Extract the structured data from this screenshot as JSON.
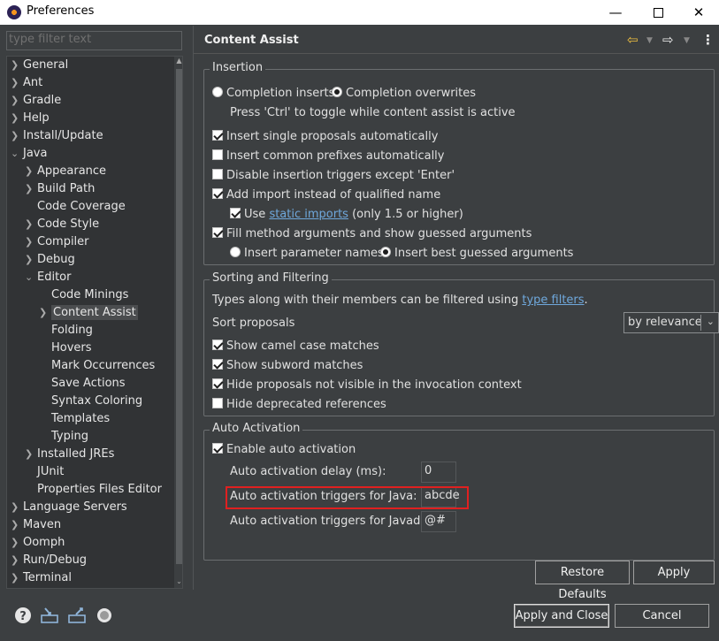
{
  "window": {
    "title": "Preferences"
  },
  "colors": {
    "background": "#3c3f41",
    "link": "#6fa8dc",
    "highlight": "#e02020"
  },
  "filter": {
    "placeholder": "type filter text"
  },
  "tree": {
    "items": [
      {
        "label": "General"
      },
      {
        "label": "Ant"
      },
      {
        "label": "Gradle"
      },
      {
        "label": "Help"
      },
      {
        "label": "Install/Update"
      },
      {
        "label": "Java"
      },
      {
        "label": "Appearance"
      },
      {
        "label": "Build Path"
      },
      {
        "label": "Code Coverage"
      },
      {
        "label": "Code Style"
      },
      {
        "label": "Compiler"
      },
      {
        "label": "Debug"
      },
      {
        "label": "Editor"
      },
      {
        "label": "Code Minings"
      },
      {
        "label": "Content Assist"
      },
      {
        "label": "Folding"
      },
      {
        "label": "Hovers"
      },
      {
        "label": "Mark Occurrences"
      },
      {
        "label": "Save Actions"
      },
      {
        "label": "Syntax Coloring"
      },
      {
        "label": "Templates"
      },
      {
        "label": "Typing"
      },
      {
        "label": "Installed JREs"
      },
      {
        "label": "JUnit"
      },
      {
        "label": "Properties Files Editor"
      },
      {
        "label": "Language Servers"
      },
      {
        "label": "Maven"
      },
      {
        "label": "Oomph"
      },
      {
        "label": "Run/Debug"
      },
      {
        "label": "Terminal"
      }
    ]
  },
  "panel": {
    "title": "Content Assist"
  },
  "insertion": {
    "label": "Insertion",
    "completion_inserts": "Completion inserts",
    "completion_overwrites": "Completion overwrites",
    "toggle_hint": "Press 'Ctrl' to toggle while content assist is active",
    "insert_single": "Insert single proposals automatically",
    "insert_common": "Insert common prefixes automatically",
    "disable_triggers": "Disable insertion triggers except 'Enter'",
    "add_import": "Add import instead of qualified name",
    "use_label": "Use",
    "static_imports_link": "static imports",
    "static_imports_suffix": "(only 1.5 or higher)",
    "fill_method": "Fill method arguments and show guessed arguments",
    "insert_param_names": "Insert parameter names",
    "insert_best_guessed": "Insert best guessed arguments"
  },
  "sorting": {
    "label": "Sorting and Filtering",
    "types_text": "Types along with their members can be filtered using",
    "type_filters_link": "type filters",
    "period": ".",
    "sort_proposals": "Sort proposals",
    "sort_value": "by relevance",
    "camel_case": "Show camel case matches",
    "subword": "Show subword matches",
    "hide_not_visible": "Hide proposals not visible in the invocation context",
    "hide_deprecated": "Hide deprecated references"
  },
  "auto_activation": {
    "label": "Auto Activation",
    "enable": "Enable auto activation",
    "delay_label": "Auto activation delay (ms):",
    "delay_value": "0",
    "java_triggers_label": "Auto activation triggers for Java:",
    "java_triggers_value": "abcde",
    "javadoc_triggers_label": "Auto activation triggers for Javadoc:",
    "javadoc_triggers_value": "@#"
  },
  "buttons": {
    "restore_defaults": "Restore Defaults",
    "apply": "Apply",
    "apply_and_close": "Apply and Close",
    "cancel": "Cancel"
  }
}
